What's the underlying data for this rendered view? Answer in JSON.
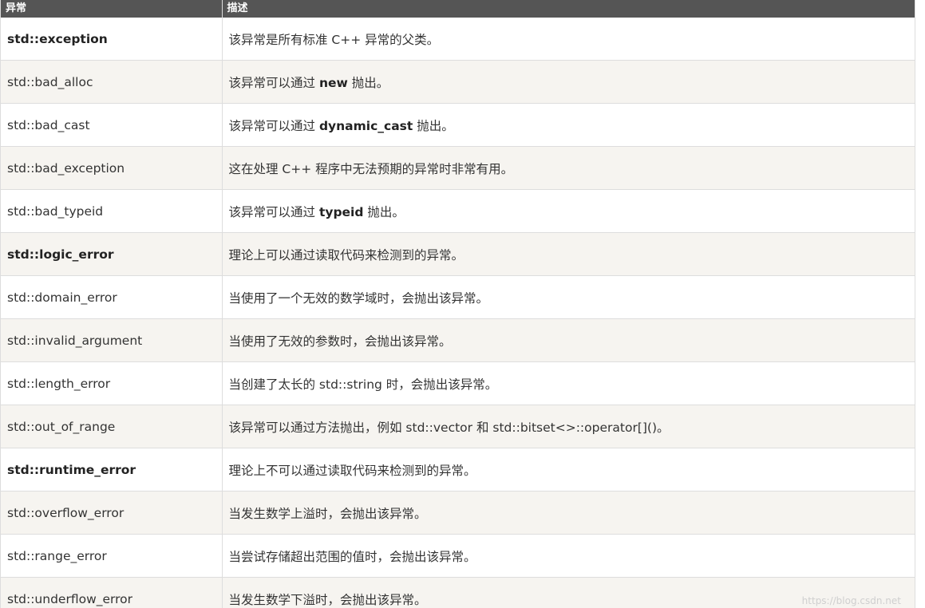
{
  "table": {
    "headers": [
      "异常",
      "描述"
    ],
    "rows": [
      {
        "name": "std::exception",
        "strong": true,
        "desc": [
          {
            "text": "该异常是所有标准 C++ 异常的父类。"
          }
        ]
      },
      {
        "name": "std::bad_alloc",
        "strong": false,
        "desc": [
          {
            "text": "该异常可以通过 "
          },
          {
            "text": "new",
            "kw": true
          },
          {
            "text": " 抛出。"
          }
        ]
      },
      {
        "name": "std::bad_cast",
        "strong": false,
        "desc": [
          {
            "text": "该异常可以通过 "
          },
          {
            "text": "dynamic_cast",
            "kw": true
          },
          {
            "text": " 抛出。"
          }
        ]
      },
      {
        "name": "std::bad_exception",
        "strong": false,
        "desc": [
          {
            "text": "这在处理 C++ 程序中无法预期的异常时非常有用。"
          }
        ]
      },
      {
        "name": "std::bad_typeid",
        "strong": false,
        "desc": [
          {
            "text": "该异常可以通过 "
          },
          {
            "text": "typeid",
            "kw": true
          },
          {
            "text": " 抛出。"
          }
        ]
      },
      {
        "name": "std::logic_error",
        "strong": true,
        "desc": [
          {
            "text": "理论上可以通过读取代码来检测到的异常。"
          }
        ]
      },
      {
        "name": "std::domain_error",
        "strong": false,
        "desc": [
          {
            "text": "当使用了一个无效的数学域时，会抛出该异常。"
          }
        ]
      },
      {
        "name": "std::invalid_argument",
        "strong": false,
        "desc": [
          {
            "text": "当使用了无效的参数时，会抛出该异常。"
          }
        ]
      },
      {
        "name": "std::length_error",
        "strong": false,
        "desc": [
          {
            "text": "当创建了太长的 std::string 时，会抛出该异常。"
          }
        ]
      },
      {
        "name": "std::out_of_range",
        "strong": false,
        "desc": [
          {
            "text": "该异常可以通过方法抛出，例如 std::vector 和 std::bitset<>::operator[]()。"
          }
        ]
      },
      {
        "name": "std::runtime_error",
        "strong": true,
        "desc": [
          {
            "text": "理论上不可以通过读取代码来检测到的异常。"
          }
        ]
      },
      {
        "name": "std::overflow_error",
        "strong": false,
        "desc": [
          {
            "text": "当发生数学上溢时，会抛出该异常。"
          }
        ]
      },
      {
        "name": "std::range_error",
        "strong": false,
        "desc": [
          {
            "text": "当尝试存储超出范围的值时，会抛出该异常。"
          }
        ]
      },
      {
        "name": "std::underflow_error",
        "strong": false,
        "desc": [
          {
            "text": "当发生数学下溢时，会抛出该异常。"
          }
        ]
      }
    ]
  },
  "watermark": "https://blog.csdn.net"
}
